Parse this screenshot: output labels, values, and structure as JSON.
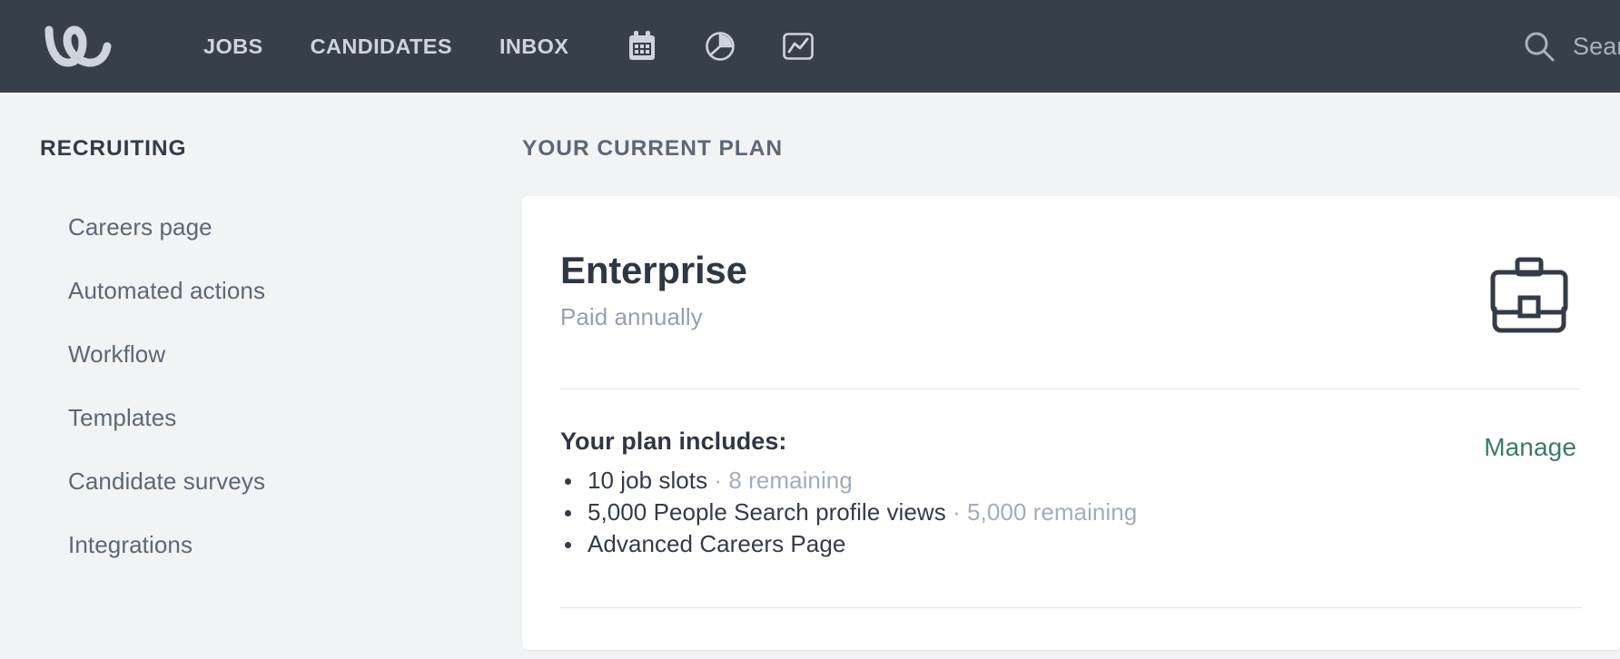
{
  "topnav": {
    "background": "#373f4b",
    "logo_name": "workable-logo",
    "links": [
      {
        "label": "JOBS",
        "name": "nav-link-jobs"
      },
      {
        "label": "CANDIDATES",
        "name": "nav-link-candidates"
      },
      {
        "label": "INBOX",
        "name": "nav-link-inbox"
      }
    ],
    "icons": [
      {
        "name": "calendar-icon",
        "label": "Calendar"
      },
      {
        "name": "pie-chart-icon",
        "label": "Reports"
      },
      {
        "name": "line-chart-icon",
        "label": "Analytics"
      }
    ],
    "search": {
      "icon_name": "search-icon",
      "placeholder": "Search",
      "visible_text": "Sea"
    }
  },
  "sidebar": {
    "heading": "RECRUITING",
    "items": [
      {
        "label": "Careers page"
      },
      {
        "label": "Automated actions"
      },
      {
        "label": "Workflow"
      },
      {
        "label": "Templates"
      },
      {
        "label": "Candidate surveys"
      },
      {
        "label": "Integrations"
      }
    ]
  },
  "main": {
    "section_title": "YOUR CURRENT PLAN",
    "card": {
      "plan_name": "Enterprise",
      "billing": "Paid annually",
      "plan_icon_name": "briefcase-icon",
      "includes_title": "Your plan includes:",
      "includes": [
        {
          "text": "10 job slots",
          "separator": " · ",
          "remaining": "8 remaining"
        },
        {
          "text": "5,000 People Search profile views",
          "separator": " · ",
          "remaining": "5,000 remaining"
        },
        {
          "text": "Advanced Careers Page",
          "separator": "",
          "remaining": ""
        }
      ],
      "manage_label": "Manage",
      "manage_color": "#3b7a6b"
    }
  }
}
